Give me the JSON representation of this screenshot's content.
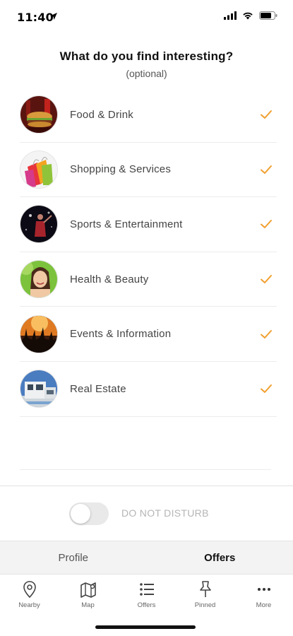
{
  "status_bar": {
    "time": "11:40",
    "icons": [
      "location-arrow-icon",
      "signal-icon",
      "wifi-icon",
      "battery-icon"
    ]
  },
  "header": {
    "title": "What do you find interesting?",
    "subtitle": "(optional)"
  },
  "categories": [
    {
      "label": "Food & Drink",
      "image": "burger-photo",
      "selected": true
    },
    {
      "label": "Shopping & Services",
      "image": "shopping-bags-photo",
      "selected": true
    },
    {
      "label": "Sports & Entertainment",
      "image": "stage-performer-photo",
      "selected": true
    },
    {
      "label": "Health & Beauty",
      "image": "smiling-woman-photo",
      "selected": true
    },
    {
      "label": "Events & Information",
      "image": "concert-crowd-photo",
      "selected": true
    },
    {
      "label": "Real Estate",
      "image": "modern-building-photo",
      "selected": true
    }
  ],
  "dnd": {
    "label": "DO NOT DISTURB",
    "on": false
  },
  "segment": {
    "profile_label": "Profile",
    "offers_label": "Offers",
    "active": "Offers"
  },
  "tabbar": {
    "tabs": [
      {
        "label": "Nearby",
        "icon": "location-pin-icon"
      },
      {
        "label": "Map",
        "icon": "map-icon"
      },
      {
        "label": "Offers",
        "icon": "list-icon"
      },
      {
        "label": "Pinned",
        "icon": "pushpin-icon"
      },
      {
        "label": "More",
        "icon": "more-dots-icon"
      }
    ]
  },
  "colors": {
    "accent": "#f0a030",
    "text_primary": "#111111",
    "text_secondary": "#444444",
    "toggle_off": "#e9e9ea",
    "segment_bg": "#f3f3f3"
  }
}
